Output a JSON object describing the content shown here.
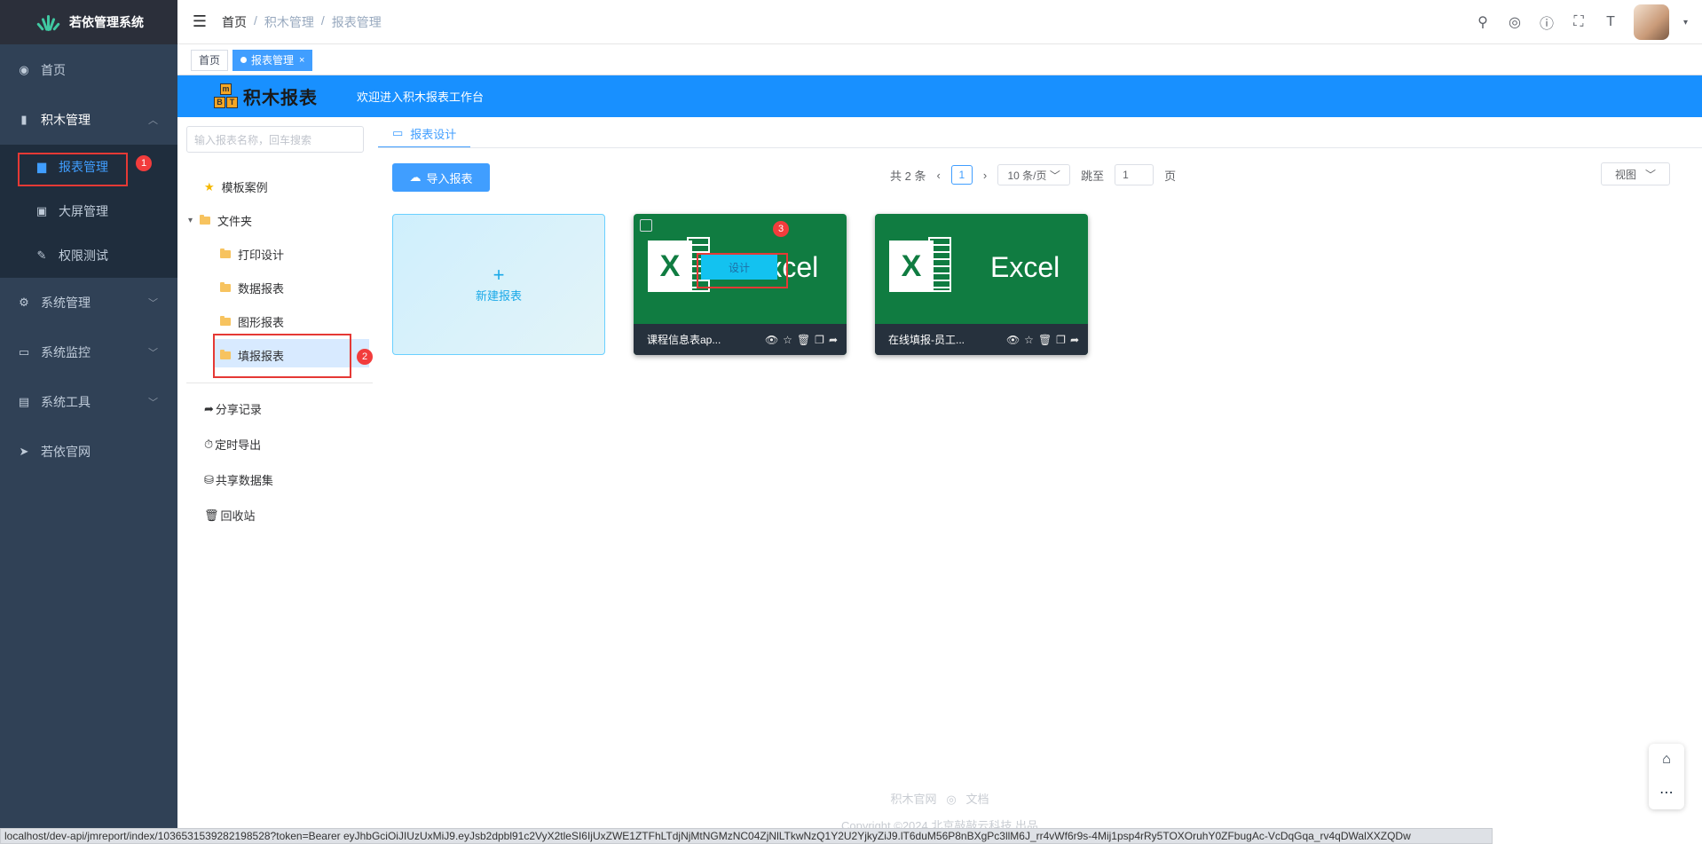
{
  "app": {
    "title": "若依管理系统"
  },
  "sidebar": {
    "home": "首页",
    "jimu": "积木管理",
    "sub": [
      "报表管理",
      "大屏管理",
      "权限测试"
    ],
    "system": "系统管理",
    "monitor": "系统监控",
    "tools": "系统工具",
    "site": "若依官网"
  },
  "breadcrumb": [
    "首页",
    "积木管理",
    "报表管理"
  ],
  "tags": {
    "home": "首页",
    "active": "报表管理",
    "close": "×"
  },
  "banner": {
    "logo_text": "积木报表",
    "welcome": "欢迎进入积木报表工作台",
    "block_letters": [
      "m",
      "B",
      "T"
    ]
  },
  "tree": {
    "search_placeholder": "输入报表名称，回车搜索",
    "template": "模板案例",
    "folder": "文件夹",
    "children": [
      "打印设计",
      "数据报表",
      "图形报表",
      "填报报表"
    ],
    "share": "分享记录",
    "timed": "定时导出",
    "dataset": "共享数据集",
    "recycle": "回收站"
  },
  "main": {
    "tab": "报表设计",
    "import_btn": "导入报表",
    "pager": {
      "total": "共 2 条",
      "page": "1",
      "size": "10 条/页",
      "jump": "跳至",
      "jump_value": "1",
      "page_unit": "页"
    },
    "view_btn": "视图",
    "new_card": {
      "plus": "+",
      "label": "新建报表"
    },
    "cards": [
      {
        "name": "课程信息表ap...",
        "excel_word": "Excel",
        "design": "设计"
      },
      {
        "name": "在线填报-员工...",
        "excel_word": "Excel"
      }
    ]
  },
  "annotations": [
    "1",
    "2",
    "3"
  ],
  "footer": {
    "link1": "积木官网",
    "link2": "文档",
    "copyright": "Copyright ©2024 北京敲敲云科技 出品"
  },
  "status_url": "localhost/dev-api/jmreport/index/1036531539282198528?token=Bearer eyJhbGciOiJIUzUxMiJ9.eyJsb2dpbl91c2VyX2tleSI6IjUxZWE1ZTFhLTdjNjMtNGMzNC04ZjNlLTkwNzQ1Y2U2YjkyZiJ9.lT6duM56P8nBXgPc3llM6J_rr4vWf6r9s-4Mij1psp4rRy5TOXOruhY0ZFbugAc-VcDqGqa_rv4qDWalXXZQDw",
  "colors": {
    "sidebar": "#304156",
    "accent": "#409eff",
    "banner": "#1890ff",
    "excel": "#107c41"
  }
}
